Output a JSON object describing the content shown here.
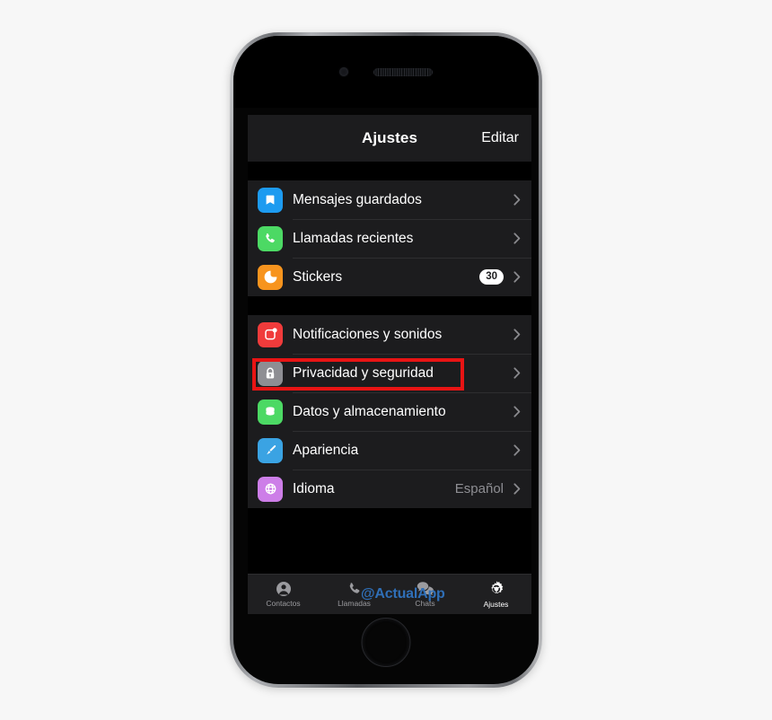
{
  "device": {
    "name": "iphone-frame",
    "camera_icon": "front-camera-icon",
    "speaker_icon": "earpiece-speaker-icon",
    "home_button_label": "home-button"
  },
  "navbar": {
    "title": "Ajustes",
    "edit_label": "Editar"
  },
  "groups": [
    {
      "rows": [
        {
          "label": "Mensajes guardados",
          "icon": "bookmark-icon",
          "icon_color": "#1d9bf0",
          "value": "",
          "badge": "",
          "chevron": "›"
        },
        {
          "label": "Llamadas recientes",
          "icon": "phone-icon",
          "icon_color": "#4cd964",
          "value": "",
          "badge": "",
          "chevron": "›"
        },
        {
          "label": "Stickers",
          "icon": "sticker-icon",
          "icon_color": "#f7941e",
          "value": "",
          "badge": "30",
          "chevron": "›"
        }
      ]
    },
    {
      "rows": [
        {
          "label": "Notificaciones y sonidos",
          "icon": "notification-bell-icon",
          "icon_color": "#f03b3b",
          "value": "",
          "badge": "",
          "chevron": "›"
        },
        {
          "label": "Privacidad y seguridad",
          "icon": "lock-icon",
          "icon_color": "#8e8e93",
          "value": "",
          "badge": "",
          "chevron": "›",
          "highlighted": true
        },
        {
          "label": "Datos y almacenamiento",
          "icon": "database-icon",
          "icon_color": "#4cd964",
          "value": "",
          "badge": "",
          "chevron": "›"
        },
        {
          "label": "Apariencia",
          "icon": "paintbrush-icon",
          "icon_color": "#3aa3e3",
          "value": "",
          "badge": "",
          "chevron": "›"
        },
        {
          "label": "Idioma",
          "icon": "globe-icon",
          "icon_color": "#cd7ee8",
          "value": "Español",
          "badge": "",
          "chevron": "›"
        }
      ]
    }
  ],
  "tabbar": {
    "items": [
      {
        "label": "Contactos",
        "icon": "contact-person-icon",
        "active": false
      },
      {
        "label": "Llamadas",
        "icon": "phone-handset-icon",
        "active": false
      },
      {
        "label": "Chats",
        "icon": "chat-bubbles-icon",
        "active": false
      },
      {
        "label": "Ajustes",
        "icon": "gear-icon",
        "active": true
      }
    ]
  },
  "watermark": {
    "text": "@ActualApp",
    "color": "#2f6fb8"
  },
  "highlight": {
    "color": "#e81414",
    "target": "Privacidad y seguridad"
  }
}
